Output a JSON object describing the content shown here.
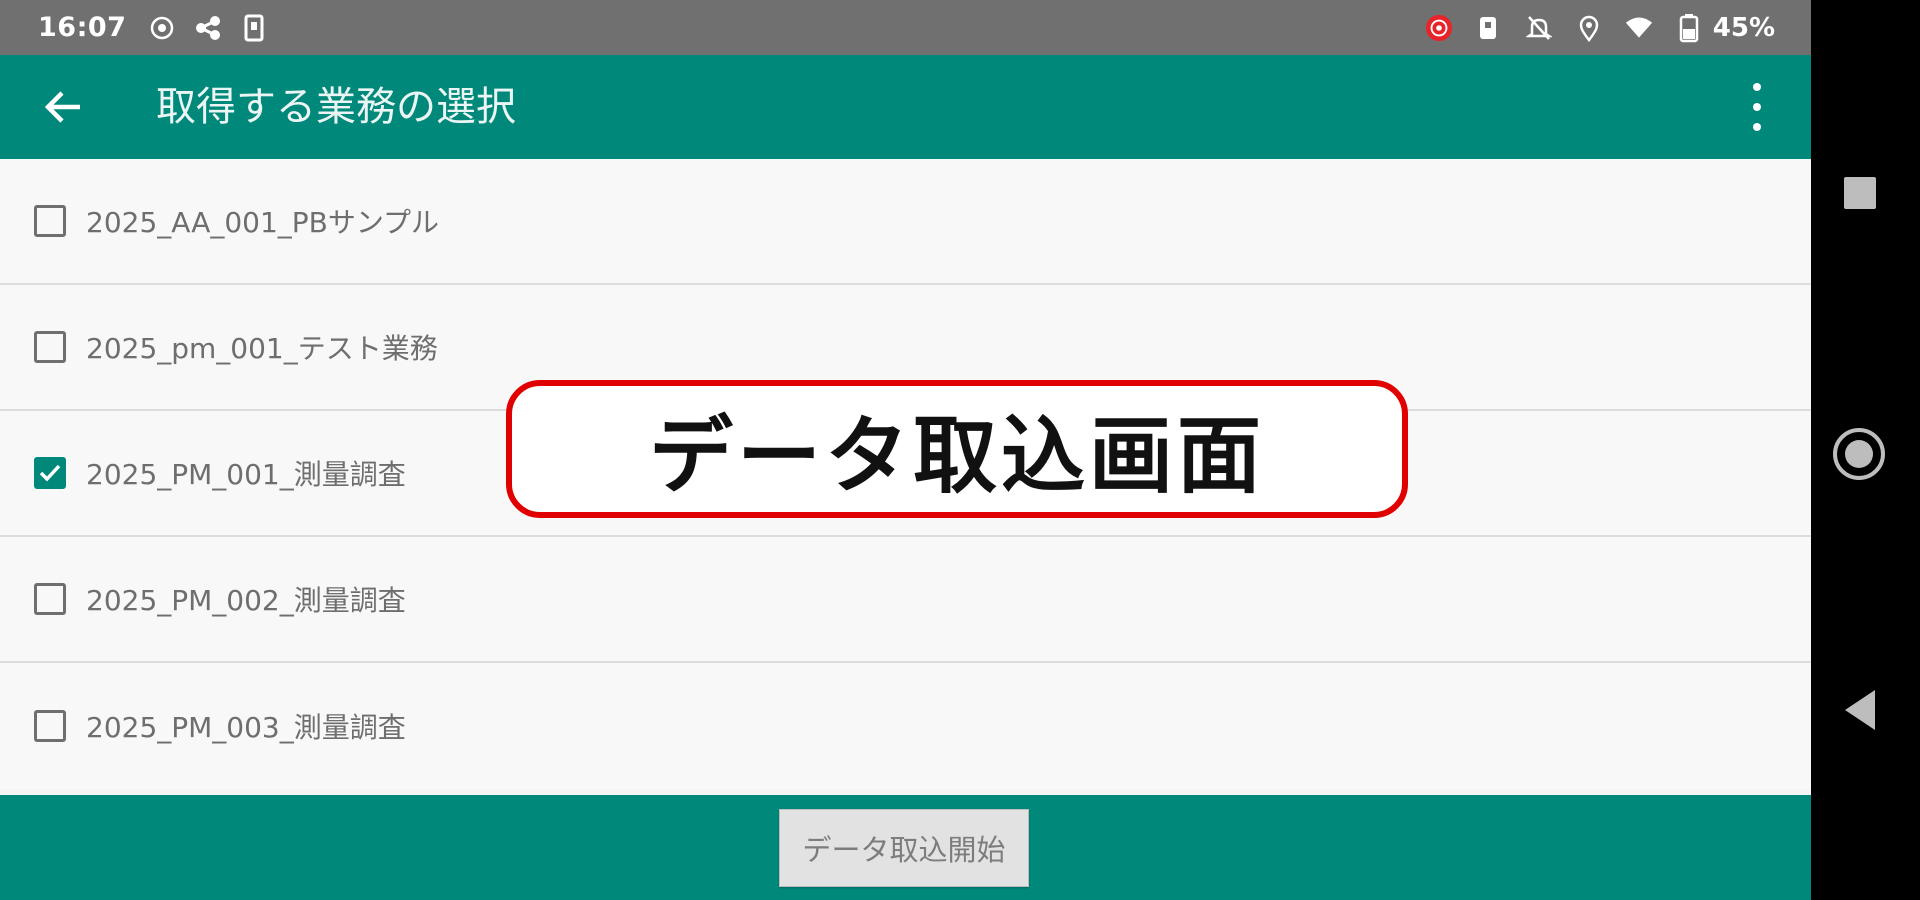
{
  "status_bar": {
    "time": "16:07",
    "battery_text": "45%",
    "left_icons": [
      "target-icon",
      "share-icon",
      "phone-icon"
    ],
    "right_icons": [
      "record-icon",
      "nfc-icon",
      "mute-icon",
      "location-icon",
      "wifi-icon",
      "battery-icon"
    ]
  },
  "app_bar": {
    "title": "取得する業務の選択",
    "back_icon": "arrow-left-icon",
    "overflow_icon": "more-vert-icon"
  },
  "list": {
    "items": [
      {
        "label": "2025_AA_001_PBサンプル",
        "checked": false
      },
      {
        "label": "2025_pm_001_テスト業務",
        "checked": false
      },
      {
        "label": "2025_PM_001_測量調査",
        "checked": true
      },
      {
        "label": "2025_PM_002_測量調査",
        "checked": false
      },
      {
        "label": "2025_PM_003_測量調査",
        "checked": false
      }
    ]
  },
  "callout": {
    "text": "データ取込画面",
    "border_color": "#e10000"
  },
  "bottom_bar": {
    "start_button_label": "データ取込開始"
  },
  "colors": {
    "primary": "#00897b",
    "status_bar": "#707070",
    "callout_border": "#e10000"
  },
  "nav_bar": {
    "icons": [
      "recents-icon",
      "home-icon",
      "back-triangle-icon"
    ]
  }
}
